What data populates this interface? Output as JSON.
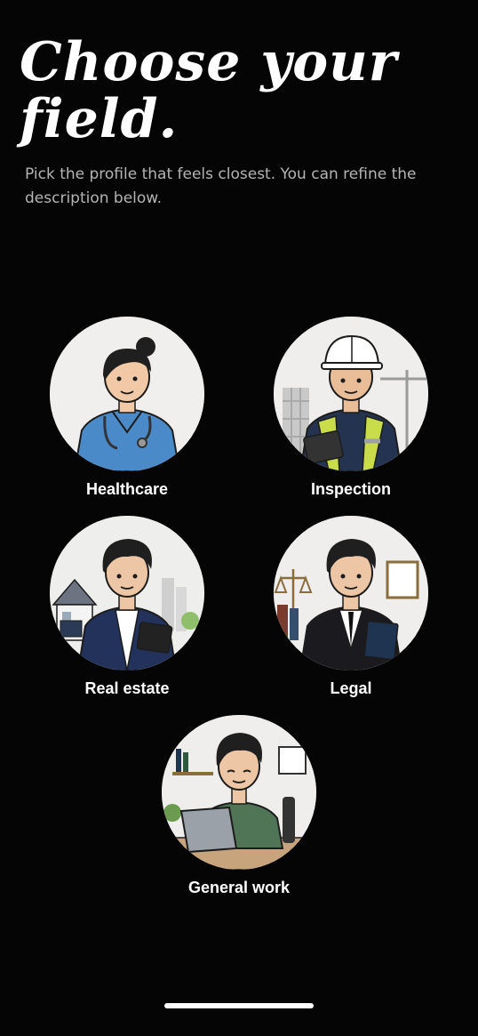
{
  "header": {
    "title_line1": "Choose your",
    "title_line2": "field.",
    "subtitle": "Pick the profile that feels closest. You can refine the description below."
  },
  "fields": [
    {
      "label": "Healthcare",
      "icon": "healthcare-worker-icon"
    },
    {
      "label": "Inspection",
      "icon": "inspector-icon"
    },
    {
      "label": "Real estate",
      "icon": "real-estate-agent-icon"
    },
    {
      "label": "Legal",
      "icon": "lawyer-icon"
    },
    {
      "label": "General work",
      "icon": "office-worker-icon"
    }
  ],
  "colors": {
    "background": "#050505",
    "text": "#ffffff",
    "subtitle": "#b4b4b4",
    "avatar_bg": "#eeeceb"
  }
}
